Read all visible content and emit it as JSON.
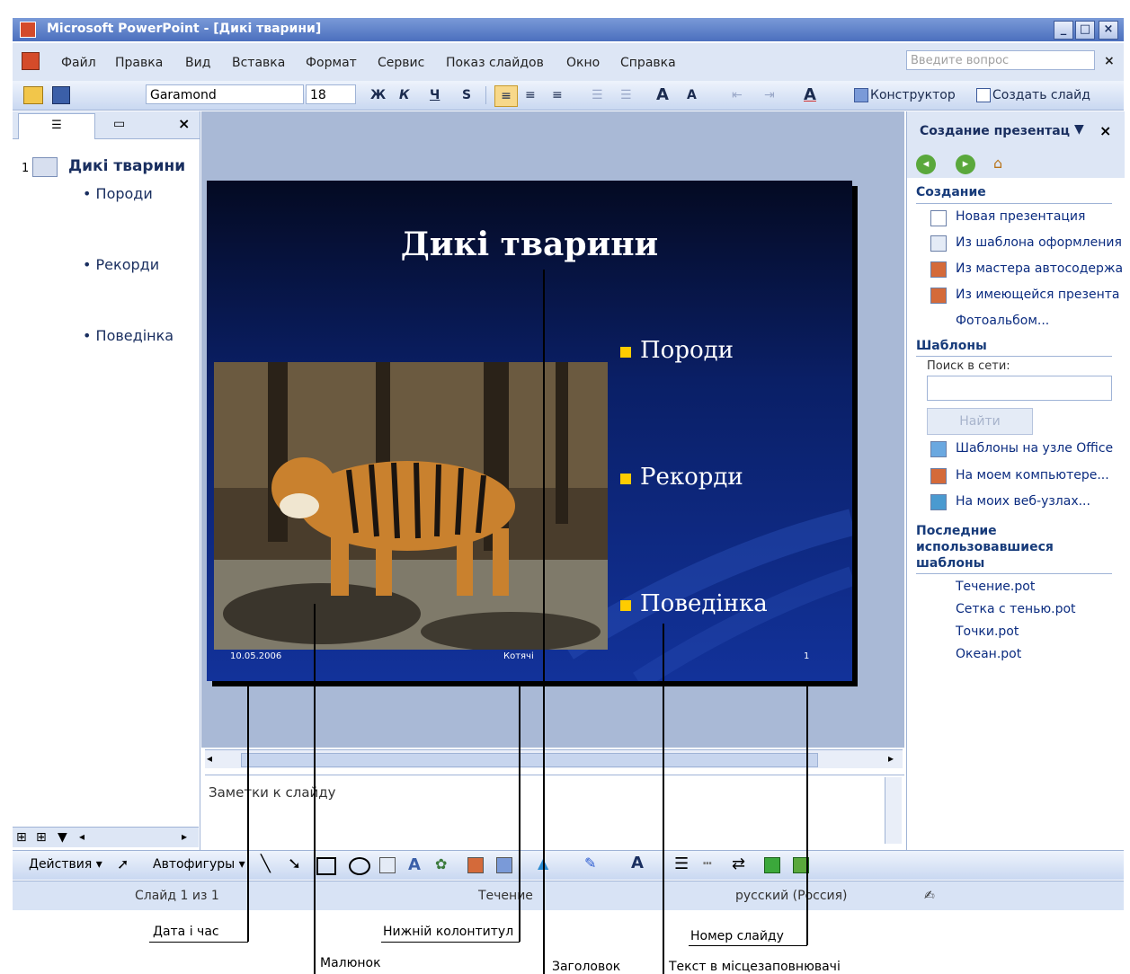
{
  "window": {
    "title": "Microsoft PowerPoint - [Дикі тварини]",
    "min": "_",
    "max": "□",
    "close": "×"
  },
  "menu": {
    "items": [
      "Файл",
      "Правка",
      "Вид",
      "Вставка",
      "Формат",
      "Сервис",
      "Показ слайдов",
      "Окно",
      "Справка"
    ],
    "help_placeholder": "Введите вопрос",
    "help_close": "×"
  },
  "toolbar": {
    "font": "Garamond",
    "size": "18",
    "bold": "Ж",
    "italic": "К",
    "underline": "Ч",
    "shadow": "S",
    "font_color": "A",
    "design": "Конструктор",
    "new_slide": "Создать слайд"
  },
  "outline": {
    "close": "×",
    "slide_number": "1",
    "slide_title": "Дикі тварини",
    "bullets": [
      "Породи",
      "Рекорди",
      "Поведінка"
    ]
  },
  "slide": {
    "title": "Дикі тварини",
    "bullets": [
      "Породи",
      "Рекорди",
      "Поведінка"
    ],
    "date": "10.05.2006",
    "footer": "Котячі",
    "number": "1"
  },
  "notes": {
    "placeholder": "Заметки к слайду"
  },
  "taskpane": {
    "title": "Создание презентац",
    "close": "×",
    "create_header": "Создание",
    "create_links": [
      "Новая презентация",
      "Из шаблона оформления",
      "Из мастера автосодержа",
      "Из имеющейся презента",
      "Фотоальбом..."
    ],
    "templates_header": "Шаблоны",
    "search_label": "Поиск в сети:",
    "search_button": "Найти",
    "template_links": [
      "Шаблоны на узле Office",
      "На моем компьютере...",
      "На моих веб-узлах..."
    ],
    "recent_header": "Последние использовавшиеся шаблоны",
    "recent": [
      "Течение.pot",
      "Сетка с тенью.pot",
      "Точки.pot",
      "Океан.pot"
    ]
  },
  "drawbar": {
    "actions": "Действия",
    "autoshapes": "Автофигуры",
    "font_color": "A"
  },
  "status": {
    "slide": "Слайд 1 из 1",
    "design": "Течение",
    "language": "русский (Россия)"
  },
  "callouts": {
    "date": "Дата і час",
    "picture": "Малюнок",
    "footer": "Нижній колонтитул",
    "title": "Заголовок",
    "number": "Номер слайду",
    "placeholder": "Текст в місцезаповнювачі"
  },
  "colors": {
    "accent": "#4b6fbe",
    "slide_bg": "#0a1f66",
    "bullet": "#ffcc00"
  }
}
